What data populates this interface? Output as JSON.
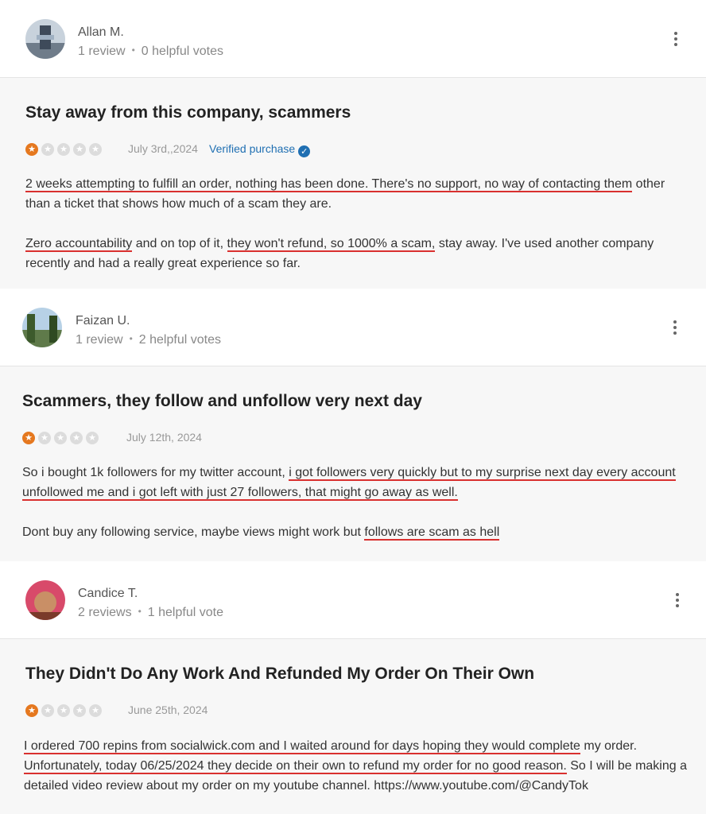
{
  "reviews": [
    {
      "reviewer": {
        "name": "Allan M.",
        "reviews": "1 review",
        "votes": "0 helpful votes"
      },
      "title": "Stay away from this company, scammers",
      "rating": 1,
      "date": "July 3rd,,2024",
      "verified": "Verified purchase",
      "body": {
        "p1_a": "2 weeks attempting to fulfill an order, nothing has been done. There's no support, no way of contacting them",
        "p1_b": " other than a ticket that shows how much of a scam they are.",
        "p2_a": "Zero accountability",
        "p2_b": " and on top of it, ",
        "p2_c": "they won't refund, so 1000% a scam,",
        "p2_d": " stay away. I've used another company recently and had a really great experience so far."
      }
    },
    {
      "reviewer": {
        "name": "Faizan U.",
        "reviews": "1 review",
        "votes": "2 helpful votes"
      },
      "title": "Scammers, they follow and unfollow very next day",
      "rating": 1,
      "date": "July 12th, 2024",
      "body": {
        "p1_a": "So i bought 1k followers for my twitter account, ",
        "p1_b": "i got followers very quickly but to my surprise next day every account unfollowed me and i got left with just 27 followers, that might go away as well.",
        "p2_a": "Dont buy any following service, maybe views might work but ",
        "p2_b": "follows are scam as hell"
      }
    },
    {
      "reviewer": {
        "name": "Candice T.",
        "reviews": "2 reviews",
        "votes": "1 helpful vote"
      },
      "title": "They Didn't Do Any Work And Refunded My Order On Their Own",
      "rating": 1,
      "date": "June 25th, 2024",
      "body": {
        "p1_a": "I ordered 700 repins from socialwick.com and I waited around for days hoping they would complete",
        "p1_b": " my order. ",
        "p1_c": "Unfortunately, today 06/25/2024 they decide on their own to refund my order for no good reason.",
        "p1_d": " So I will be making a detailed video review about my order on my youtube channel. https://www.youtube.com/@CandyTok"
      }
    }
  ],
  "colors": {
    "star_on": "#e5781f",
    "underline": "#d9302f",
    "verified": "#1f6fb2"
  }
}
